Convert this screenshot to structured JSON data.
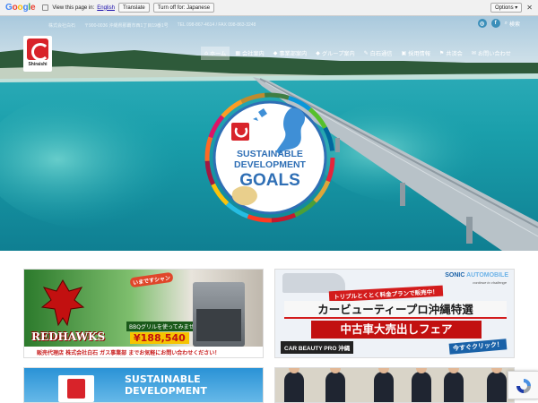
{
  "translate_bar": {
    "logo_text": "Google",
    "view_text": "View this page in:",
    "language": "English",
    "translate_label": "Translate",
    "turn_off_label": "Turn off for: Japanese",
    "options_label": "Options ▾",
    "close_label": "✕"
  },
  "header": {
    "company": "株式会社白石",
    "address": "〒900-0036 沖縄県那覇市西1丁目19番1号",
    "phone": "TEL 098-867-4614 / FAX 098-863-3248",
    "instagram_label": "◎",
    "facebook_label": "f",
    "search_label": "検索",
    "logo_name": "Shiraishi"
  },
  "nav": {
    "items": [
      {
        "label": "ホーム",
        "icon": "⌂"
      },
      {
        "label": "会社案内",
        "icon": "▦"
      },
      {
        "label": "事業部案内",
        "icon": "◆"
      },
      {
        "label": "グループ案内",
        "icon": "◆"
      },
      {
        "label": "白石通信",
        "icon": "✎"
      },
      {
        "label": "採用情報",
        "icon": "▣"
      },
      {
        "label": "共済会",
        "icon": "⚑"
      },
      {
        "label": "お問い合わせ",
        "icon": "✉"
      }
    ]
  },
  "sdg_badge": {
    "line1": "SUSTAINABLE",
    "line2": "DEVELOPMENT",
    "line3": "GOALS"
  },
  "banners": {
    "redhawks": {
      "title": "REDHAWKS",
      "speech": "いまですシャン",
      "sub": "BBQグリルを使ってみませんか",
      "price": "¥188,540",
      "bottom": "販売代理店 株式会社白石 ガス事業部 までお気軽にお問い合わせください！"
    },
    "sonic": {
      "brand_a": "SONIC",
      "brand_b": "AUTOMOBILE",
      "tagline": "continue to challenge",
      "promo": "トリプルとくとく料金プランで販売中！",
      "main": "カービューティープロ沖縄特選",
      "main2": "中古車大売出しフェア",
      "cbp": "CAR BEAUTY PRO 沖縄",
      "click": "今すぐクリック！"
    },
    "sdg2": {
      "line1": "SUSTAINABLE",
      "line2": "DEVELOPMENT"
    }
  },
  "colors": {
    "brand_red": "#d8232a",
    "sea": "#1ba8b4",
    "sky": "#bcd6e6"
  }
}
